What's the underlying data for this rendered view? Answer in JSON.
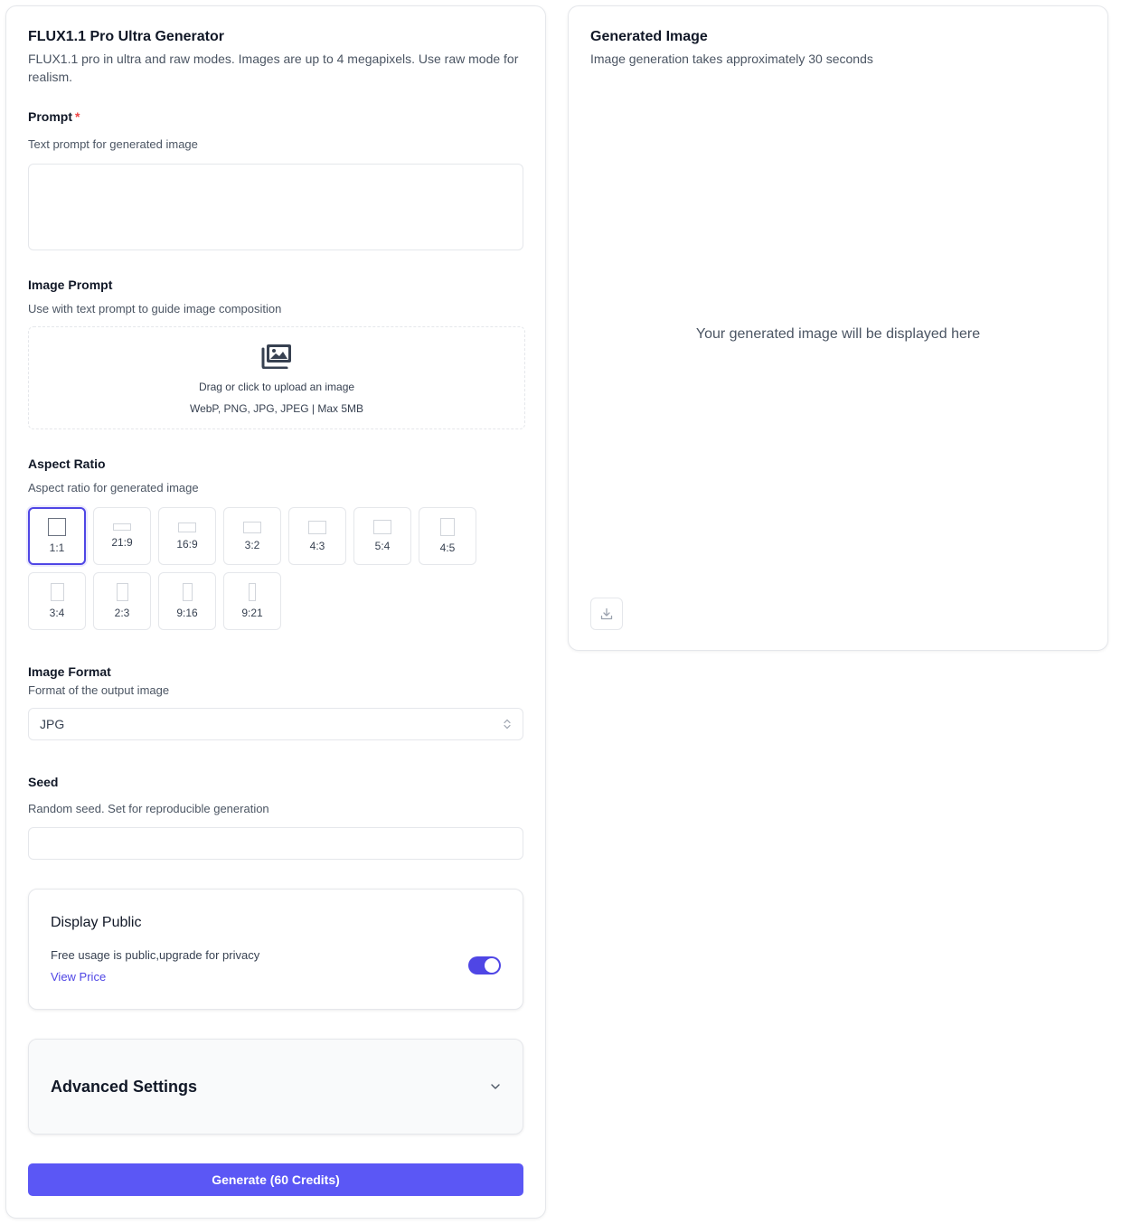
{
  "form": {
    "title": "FLUX1.1 Pro Ultra Generator",
    "description": "FLUX1.1 pro in ultra and raw modes. Images are up to 4 megapixels. Use raw mode for realism.",
    "prompt": {
      "label": "Prompt",
      "required_mark": "*",
      "description": "Text prompt for generated image",
      "value": ""
    },
    "image_prompt": {
      "label": "Image Prompt",
      "description": "Use with text prompt to guide image composition",
      "drop_text": "Drag or click to upload an image",
      "drop_hint": "WebP, PNG, JPG, JPEG | Max 5MB"
    },
    "aspect_ratio": {
      "label": "Aspect Ratio",
      "description": "Aspect ratio for generated image",
      "selected": "1:1",
      "options": [
        "1:1",
        "21:9",
        "16:9",
        "3:2",
        "4:3",
        "5:4",
        "4:5",
        "3:4",
        "2:3",
        "9:16",
        "9:21"
      ]
    },
    "image_format": {
      "label": "Image Format",
      "description": "Format of the output image",
      "value": "JPG"
    },
    "seed": {
      "label": "Seed",
      "description": "Random seed. Set for reproducible generation",
      "value": ""
    },
    "display_public": {
      "title": "Display Public",
      "description": "Free usage is public,upgrade for privacy",
      "link": "View Price",
      "enabled": true
    },
    "advanced": {
      "title": "Advanced Settings"
    },
    "generate_label": "Generate (60 Credits)"
  },
  "output": {
    "title": "Generated Image",
    "description": "Image generation takes approximately 30 seconds",
    "placeholder": "Your generated image will be displayed here"
  },
  "colors": {
    "accent": "#4f46e5",
    "button": "#5b57f5",
    "required": "#ef4444",
    "border": "#e5e7eb"
  },
  "icons": {
    "upload": "image-stack-icon",
    "select": "chevron-up-down-icon",
    "advanced": "chevron-down-icon",
    "download": "download-icon"
  }
}
